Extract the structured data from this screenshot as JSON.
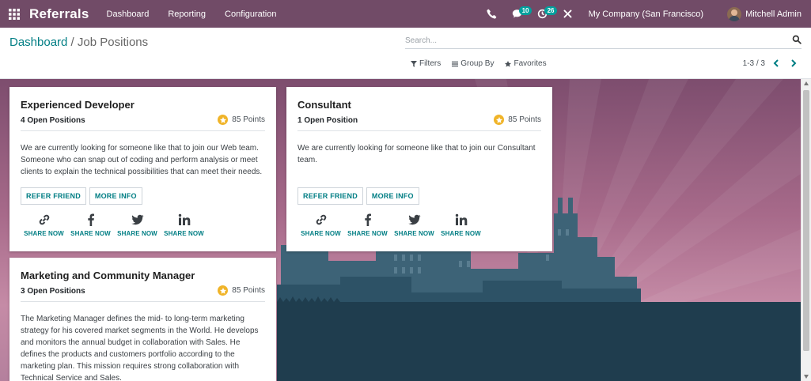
{
  "navbar": {
    "app_name": "Referrals",
    "menu": [
      "Dashboard",
      "Reporting",
      "Configuration"
    ],
    "messages_count": "10",
    "activities_count": "26",
    "company": "My Company (San Francisco)",
    "user": "Mitchell Admin",
    "color": "#714B67"
  },
  "control_panel": {
    "breadcrumb_link": "Dashboard",
    "breadcrumb_sep": " / ",
    "breadcrumb_current": "Job Positions",
    "search_placeholder": "Search...",
    "filters_label": "Filters",
    "groupby_label": "Group By",
    "favorites_label": "Favorites",
    "pager": "1-3 / 3"
  },
  "jobs": [
    {
      "title": "Experienced Developer",
      "open_positions": "4 Open Positions",
      "points": "85 Points",
      "description": "We are currently looking for someone like that to join our Web team. Someone who can snap out of coding and perform analysis or meet clients to explain the technical possibilities that can meet their needs.",
      "refer_label": "REFER FRIEND",
      "more_label": "MORE INFO",
      "share_label": "SHARE NOW"
    },
    {
      "title": "Consultant",
      "open_positions": "1 Open Position",
      "points": "85 Points",
      "description": "We are currently looking for someone like that to join our Consultant team.",
      "refer_label": "REFER FRIEND",
      "more_label": "MORE INFO",
      "share_label": "SHARE NOW"
    },
    {
      "title": "Marketing and Community Manager",
      "open_positions": "3 Open Positions",
      "points": "85 Points",
      "description": "The Marketing Manager defines the mid- to long-term marketing strategy for his covered market segments in the World. He develops and monitors the annual budget in collaboration with Sales. He defines the products and customers portfolio according to the marketing plan. This mission requires strong collaboration with Technical Service and Sales."
    }
  ],
  "accent_color": "#017e84",
  "share_icons": [
    "link-icon",
    "facebook-icon",
    "twitter-icon",
    "linkedin-icon"
  ]
}
